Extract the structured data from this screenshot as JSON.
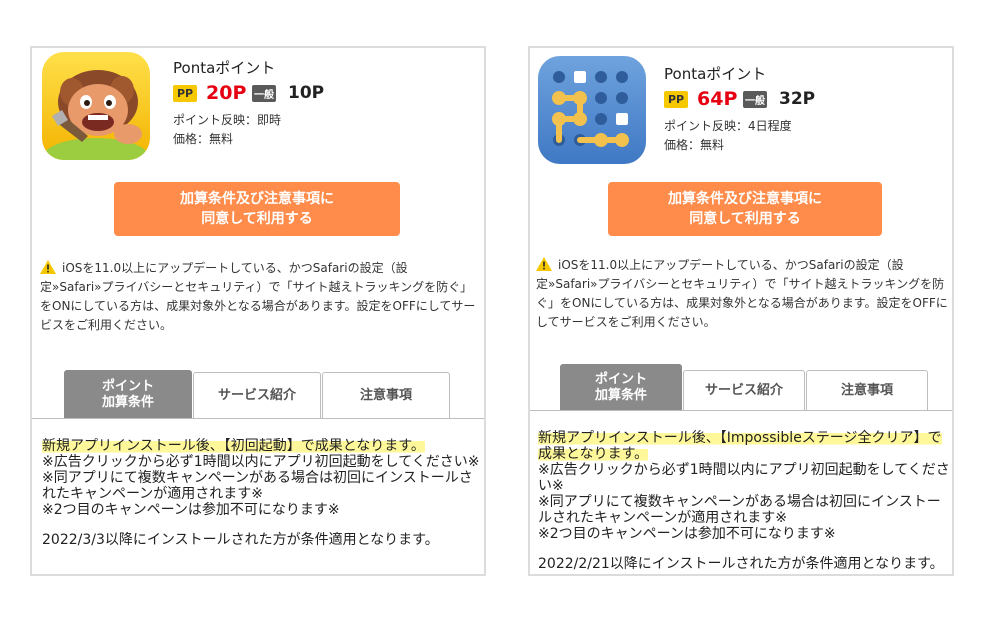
{
  "colors": {
    "cta": "#ff8c4b",
    "pp_badge": "#f6c800",
    "pp_points": "#e60012",
    "general_badge": "#5a5a5a",
    "active_tab": "#8a8a8a",
    "highlight": "#fff89a"
  },
  "panels": [
    {
      "icon": "caveman-game-app-icon",
      "app_name": "Pontaポイント",
      "pp_badge": "PP",
      "pp_points": "20P",
      "general_badge": "一般",
      "general_points": "10P",
      "reflection": "ポイント反映：即時",
      "price": "価格：無料",
      "cta_line1": "加算条件及び注意事項に",
      "cta_line2": "同意して利用する",
      "warning": "iOSを11.0以上にアップデートしている、かつSafariの設定（設定»Safari»プライバシーとセキュリティ）で「サイト越えトラッキングを防ぐ」をONにしている方は、成果対象外となる場合があります。設定をOFFにしてサービスをご利用ください。",
      "tabs": [
        {
          "line1": "ポイント",
          "line2": "加算条件"
        },
        {
          "line1": "サービス紹介",
          "line2": ""
        },
        {
          "line1": "注意事項",
          "line2": ""
        }
      ],
      "condition_highlight": "新規アプリインストール後、【初回起動】で成果となります。",
      "notes": [
        "※広告クリックから必ず1時間以内にアプリ初回起動をしてください※",
        "※同アプリにて複数キャンペーンがある場合は初回にインストールされたキャンペーンが適用されます※",
        "※2つ目のキャンペーンは参加不可になります※"
      ],
      "date_note": "2022/3/3以降にインストールされた方が条件適用となります。"
    },
    {
      "icon": "dot-puzzle-app-icon",
      "app_name": "Pontaポイント",
      "pp_badge": "PP",
      "pp_points": "64P",
      "general_badge": "一般",
      "general_points": "32P",
      "reflection": "ポイント反映：4日程度",
      "price": "価格：無料",
      "cta_line1": "加算条件及び注意事項に",
      "cta_line2": "同意して利用する",
      "warning": "iOSを11.0以上にアップデートしている、かつSafariの設定（設定»Safari»プライバシーとセキュリティ）で「サイト越えトラッキングを防ぐ」をONにしている方は、成果対象外となる場合があります。設定をOFFにしてサービスをご利用ください。",
      "tabs": [
        {
          "line1": "ポイント",
          "line2": "加算条件"
        },
        {
          "line1": "サービス紹介",
          "line2": ""
        },
        {
          "line1": "注意事項",
          "line2": ""
        }
      ],
      "condition_highlight": "新規アプリインストール後、【Impossibleステージ全クリア】で成果となります。",
      "notes": [
        "※広告クリックから必ず1時間以内にアプリ初回起動をしてください※",
        "※同アプリにて複数キャンペーンがある場合は初回にインストールされたキャンペーンが適用されます※",
        "※2つ目のキャンペーンは参加不可になります※"
      ],
      "date_note": "2022/2/21以降にインストールされた方が条件適用となります。"
    }
  ]
}
